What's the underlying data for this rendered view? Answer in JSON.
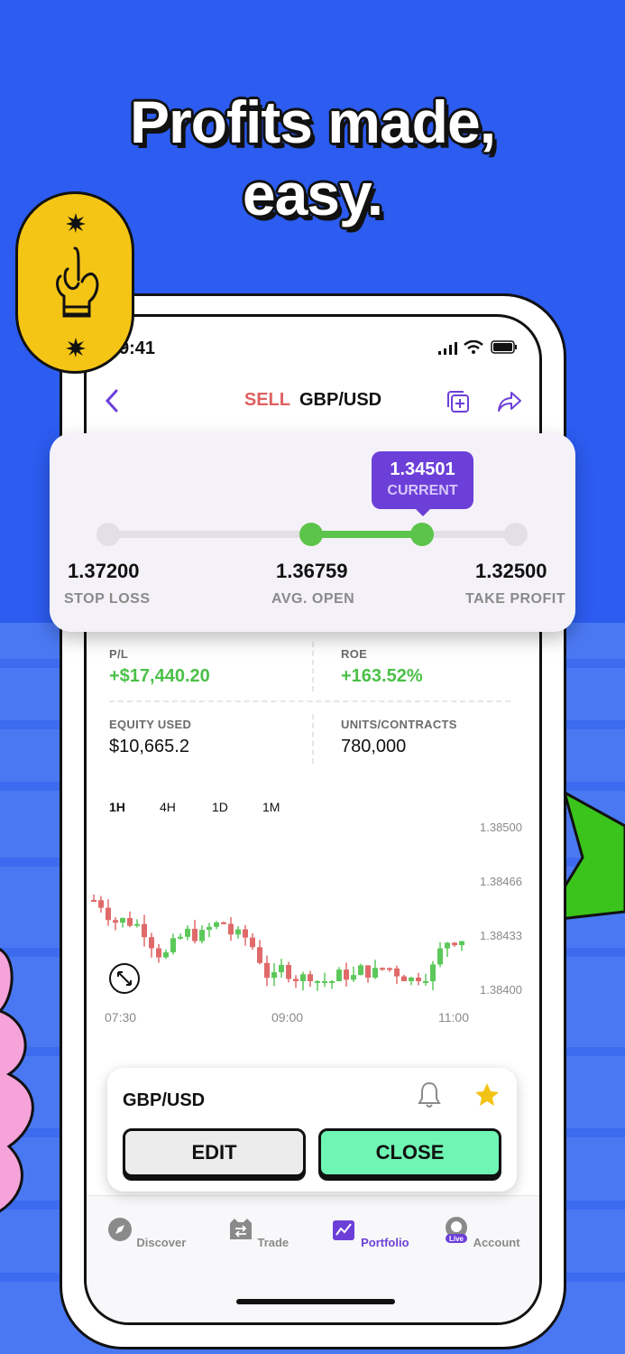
{
  "headline": {
    "line1": "Profits made,",
    "line2": "easy."
  },
  "badge": {
    "icon": "hand-gesture-icon"
  },
  "status_bar": {
    "time": "9:41"
  },
  "nav": {
    "side": "SELL",
    "pair": "GBP/USD"
  },
  "range_card": {
    "current_value": "1.34501",
    "current_label": "CURRENT",
    "stop_loss_value": "1.37200",
    "stop_loss_label": "STOP LOSS",
    "avg_open_value": "1.36759",
    "avg_open_label": "AVG. OPEN",
    "take_profit_value": "1.32500",
    "take_profit_label": "TAKE PROFIT"
  },
  "stats": {
    "pl_label": "P/L",
    "pl_value": "+$17,440.20",
    "roe_label": "ROE",
    "roe_value": "+163.52%",
    "equity_label": "EQUITY USED",
    "equity_value": "$10,665.2",
    "units_label": "UNITS/CONTRACTS",
    "units_value": "780,000"
  },
  "timeframes": [
    "1H",
    "4H",
    "1D",
    "1M"
  ],
  "chart_data": {
    "type": "candlestick",
    "y_ticks": [
      "1.38500",
      "1.38466",
      "1.38433",
      "1.38400"
    ],
    "x_ticks": [
      "07:30",
      "09:00",
      "11:00"
    ],
    "ylim": [
      1.384,
      1.385
    ]
  },
  "position_card": {
    "pair": "GBP/USD",
    "edit_label": "EDIT",
    "close_label": "CLOSE"
  },
  "tabs": [
    {
      "label": "Discover",
      "icon": "compass-icon"
    },
    {
      "label": "Trade",
      "icon": "trade-icon"
    },
    {
      "label": "Portfolio",
      "icon": "portfolio-icon"
    },
    {
      "label": "Account",
      "icon": "account-icon",
      "badge": "Live"
    }
  ],
  "colors": {
    "accent": "#6c3fd8",
    "up": "#5cc85a",
    "down": "#e06a6a",
    "close_btn": "#6ff5b4"
  }
}
